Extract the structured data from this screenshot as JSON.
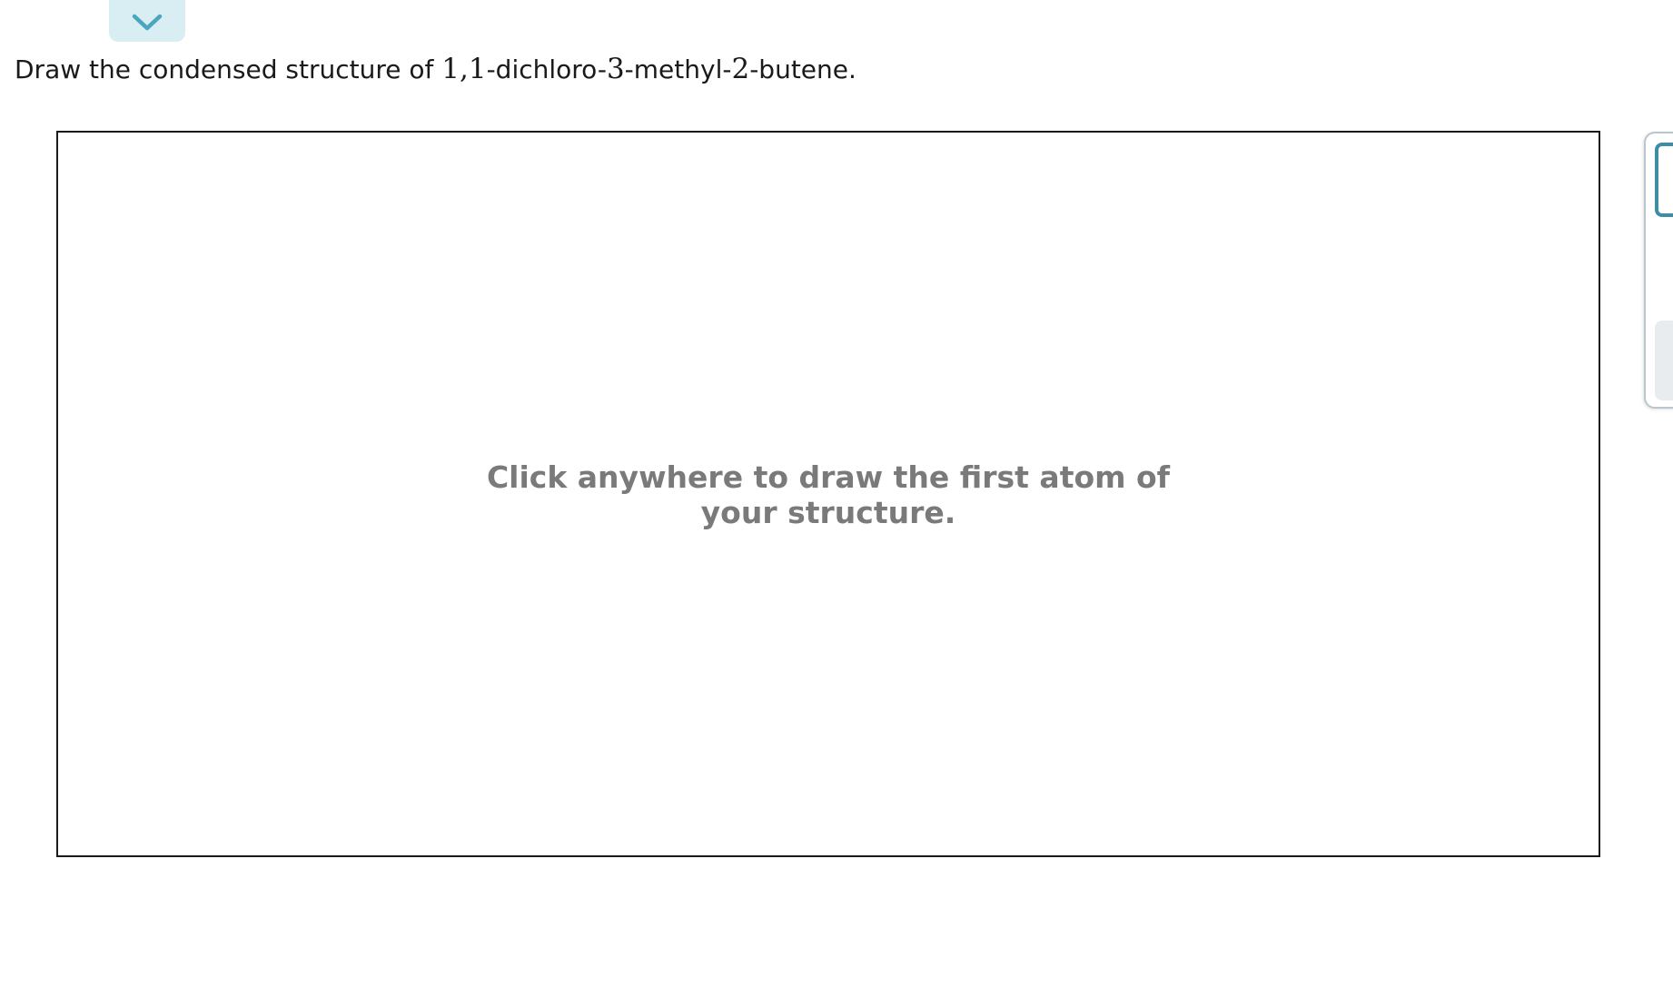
{
  "header": {
    "collapse_icon": "chevron-down-icon"
  },
  "question": {
    "prefix": "Draw the condensed structure of ",
    "locant_1": "1",
    "comma": ",",
    "locant_2": "1",
    "part_1": "-dichloro-",
    "locant_3": "3",
    "part_2": "-methyl-",
    "locant_4": "2",
    "part_3": "-butene."
  },
  "canvas": {
    "hint": "Click anywhere to draw the first atom of your structure."
  },
  "colors": {
    "accent": "#3b8ea5",
    "tab_bg": "#d8eef3",
    "hint_text": "#7a7a7a"
  }
}
